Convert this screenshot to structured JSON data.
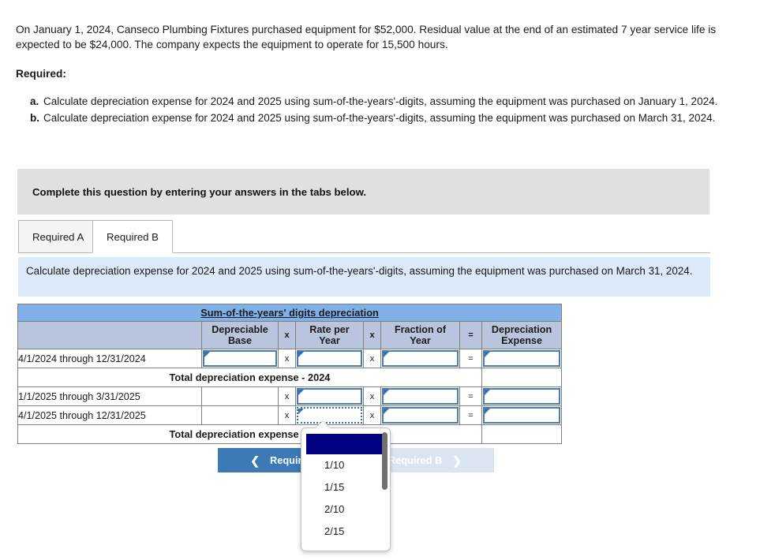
{
  "problem": {
    "statement": "On January 1, 2024, Canseco Plumbing Fixtures purchased equipment for $52,000. Residual value at the end of an estimated 7 year service life is expected to be $24,000. The company expects the equipment to operate for 15,500 hours.",
    "required_heading": "Required:",
    "items": [
      {
        "marker": "a.",
        "text": "Calculate depreciation expense for 2024 and 2025 using sum-of-the-years'-digits, assuming the equipment was purchased on January 1, 2024."
      },
      {
        "marker": "b.",
        "text": "Calculate depreciation expense for 2024 and 2025 using sum-of-the-years'-digits, assuming the equipment was purchased on March 31, 2024."
      }
    ]
  },
  "instruction_bar": {
    "text": "Complete this question by entering your answers in the tabs below."
  },
  "tabs": [
    {
      "label": "Required A",
      "active": false
    },
    {
      "label": "Required B",
      "active": true
    }
  ],
  "info_banner": {
    "text": "Calculate depreciation expense for 2024 and 2025 using sum-of-the-years'-digits, assuming the equipment was purchased on March 31, 2024."
  },
  "worksheet": {
    "title": "Sum-of-the-years' digits depreciation",
    "headers": {
      "blank": "",
      "depreciable_base": "Depreciable Base",
      "depreciable_base_l1": "Depreciable",
      "depreciable_base_l2": "Base",
      "op1": "x",
      "rate_per_year_l1": "Rate per",
      "rate_per_year_l2": "Year",
      "op2": "x",
      "fraction_of_year_l1": "Fraction of",
      "fraction_of_year_l2": "Year",
      "equals": "=",
      "depreciation_expense_l1": "Depreciation",
      "depreciation_expense_l2": "Expense"
    },
    "rows": [
      {
        "label": "4/1/2024 through 12/31/2024",
        "base_value": "",
        "rate_value": "",
        "fraction_value": "",
        "expense_value": ""
      },
      {
        "label": "Total depreciation expense - 2024",
        "total_value": ""
      },
      {
        "label": "1/1/2025 through 3/31/2025",
        "base_value": "",
        "rate_value": "",
        "fraction_value": "",
        "expense_value": ""
      },
      {
        "label": "4/1/2025 through 12/31/2025",
        "base_value": "",
        "rate_value": "",
        "fraction_value": "",
        "expense_value": ""
      },
      {
        "label": "Total depreciation expense - 2025",
        "total_value": ""
      }
    ],
    "operators": {
      "times": "x",
      "equals": "="
    }
  },
  "dropdown": {
    "selected_value": "",
    "options": [
      "",
      "1/10",
      "1/15",
      "2/10",
      "2/15"
    ]
  },
  "navigation": {
    "prev_label": "Required A",
    "next_label": "Required B",
    "prev_icon": "chevron-left-icon",
    "next_icon": "chevron-right-icon"
  },
  "colors": {
    "title_bar": "#7fb0e8",
    "header_row": "#b9c5dc",
    "total_cell": "#fdfbb5",
    "info_banner": "#dce9f7",
    "instruction_bar": "#e0e0e0",
    "nav_prev": "#3b7ab5",
    "nav_next": "#dbe5f1",
    "input_border": "#4b7cb0",
    "dropdown_selected": "#000080"
  }
}
